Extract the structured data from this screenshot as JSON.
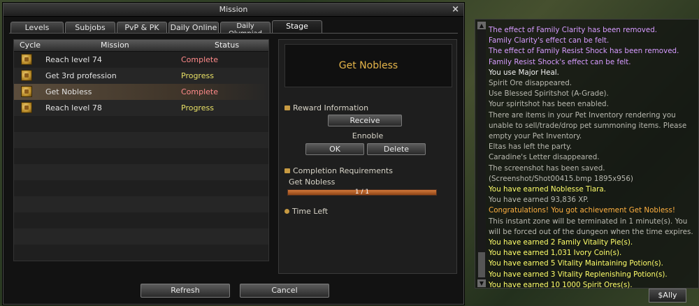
{
  "mission": {
    "title": "Mission",
    "close_glyph": "×",
    "tabs": [
      "Levels",
      "Subjobs",
      "PvP & PK",
      "Daily Online",
      "Daily Olympiad",
      "Stage"
    ],
    "columns": {
      "cycle": "Cycle",
      "mission": "Mission",
      "status": "Status"
    },
    "rows": [
      {
        "mission": "Reach level 74",
        "status": "Complete"
      },
      {
        "mission": "Get 3rd profession",
        "status": "Progress"
      },
      {
        "mission": "Get Nobless",
        "status": "Complete"
      },
      {
        "mission": "Reach level 78",
        "status": "Progress"
      }
    ],
    "stage": {
      "title": "Get Nobless",
      "reward_label": "Reward Information",
      "receive_label": "Receive",
      "reward_name": "Ennoble",
      "ok_label": "OK",
      "delete_label": "Delete",
      "requirements_label": "Completion Requirements",
      "requirement_name": "Get Nobless",
      "progress_text": "1 / 1",
      "progress_fraction": 1.0,
      "time_left_label": "Time Left"
    },
    "refresh_label": "Refresh",
    "cancel_label": "Cancel"
  },
  "chat": {
    "lines": [
      {
        "text": "The effect of Family Clarity has been removed.",
        "color": "purple"
      },
      {
        "text": "Family Clarity's effect can be felt.",
        "color": "purple"
      },
      {
        "text": "The effect of Family Resist Shock has been removed.",
        "color": "purple"
      },
      {
        "text": "Family Resist Shock's effect can be felt.",
        "color": "purple"
      },
      {
        "text": "You use Major Heal.",
        "color": "white"
      },
      {
        "text": "Spirit Ore disappeared.",
        "color": "gray"
      },
      {
        "text": "Use Blessed Spiritshot (A-Grade).",
        "color": "gray"
      },
      {
        "text": "Your spiritshot has been enabled.",
        "color": "gray"
      },
      {
        "text": "There are items in your Pet Inventory rendering you unable to sell/trade/drop pet summoning items. Please empty your Pet Inventory.",
        "color": "gray"
      },
      {
        "text": "Eltas has left the party.",
        "color": "gray"
      },
      {
        "text": "Caradine's Letter disappeared.",
        "color": "gray"
      },
      {
        "text": "The screenshot has been saved. (Screenshot/Shot00415.bmp 1895x956)",
        "color": "gray"
      },
      {
        "text": "You have earned Noblesse Tiara.",
        "color": "yellow"
      },
      {
        "text": "You have earned 93,836 XP.",
        "color": "gray"
      },
      {
        "text": "Congratulations! You got achievement Get Nobless!",
        "color": "orange"
      },
      {
        "text": "This instant zone will be terminated in 1 minute(s). You will be forced out of the dungeon when the time expires.",
        "color": "gray"
      },
      {
        "text": "You have earned 2 Family Vitality Pie(s).",
        "color": "yellow"
      },
      {
        "text": "You have earned 1,031 Ivory Coin(s).",
        "color": "yellow"
      },
      {
        "text": "You have earned 5 Vitality Maintaining Potion(s).",
        "color": "yellow"
      },
      {
        "text": "You have earned 3 Vitality Replenishing Potion(s).",
        "color": "yellow"
      },
      {
        "text": "You have earned 10 1000 Spirit Ores(s).",
        "color": "yellow"
      }
    ],
    "ally_tab": "$Ally"
  }
}
